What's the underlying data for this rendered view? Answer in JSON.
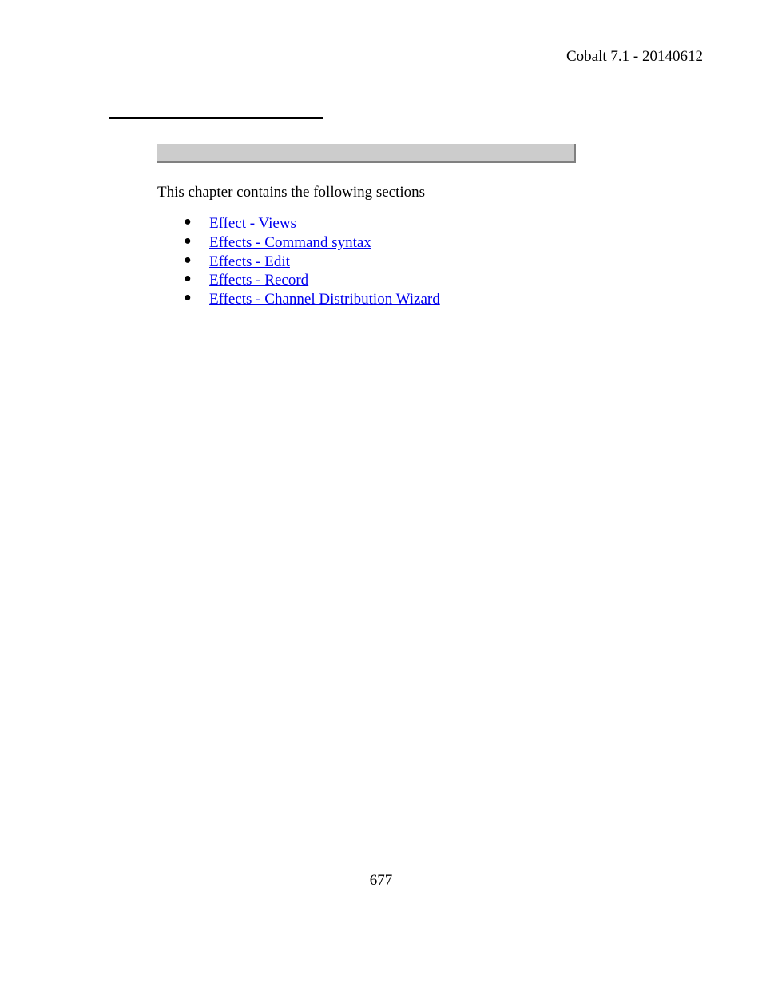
{
  "header": {
    "text": "Cobalt 7.1 - 20140612"
  },
  "intro": {
    "text": "This chapter contains the following sections"
  },
  "links": {
    "items": [
      {
        "label": "Effect - Views"
      },
      {
        "label": "Effects - Command syntax"
      },
      {
        "label": "Effects - Edit"
      },
      {
        "label": "Effects - Record"
      },
      {
        "label": "Effects - Channel Distribution Wizard"
      }
    ]
  },
  "footer": {
    "page_number": "677"
  }
}
